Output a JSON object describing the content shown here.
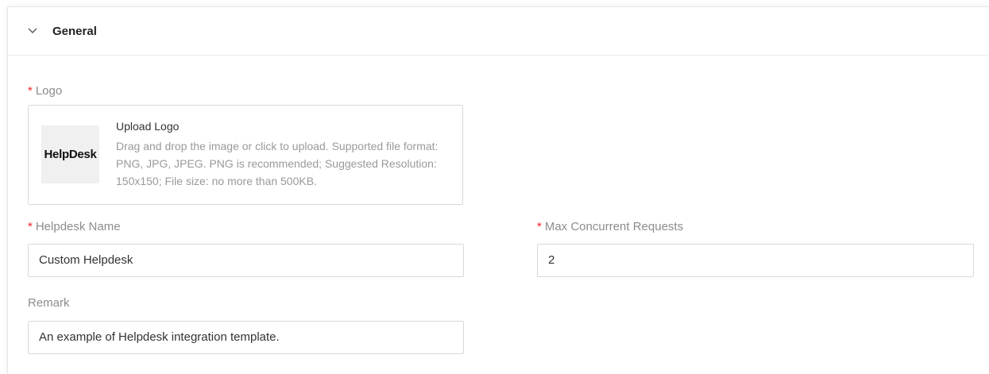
{
  "section": {
    "title": "General",
    "chevron_icon": "chevron-down-icon"
  },
  "logo": {
    "label": "Logo",
    "required_mark": "*",
    "thumbnail_text": "HelpDesk",
    "upload_title": "Upload Logo",
    "upload_description": "Drag and drop the image or click to upload. Supported file format: PNG, JPG, JPEG. PNG is recommended; Suggested Resolution: 150x150; File size: no more than 500KB."
  },
  "helpdesk_name": {
    "label": "Helpdesk Name",
    "required_mark": "*",
    "value": "Custom Helpdesk"
  },
  "max_concurrent_requests": {
    "label": "Max Concurrent Requests",
    "required_mark": "*",
    "value": "2"
  },
  "remark": {
    "label": "Remark",
    "value": "An example of Helpdesk integration template."
  },
  "colors": {
    "required": "#f5222d",
    "label": "#8c8c8c",
    "border": "#d9d9d9"
  }
}
